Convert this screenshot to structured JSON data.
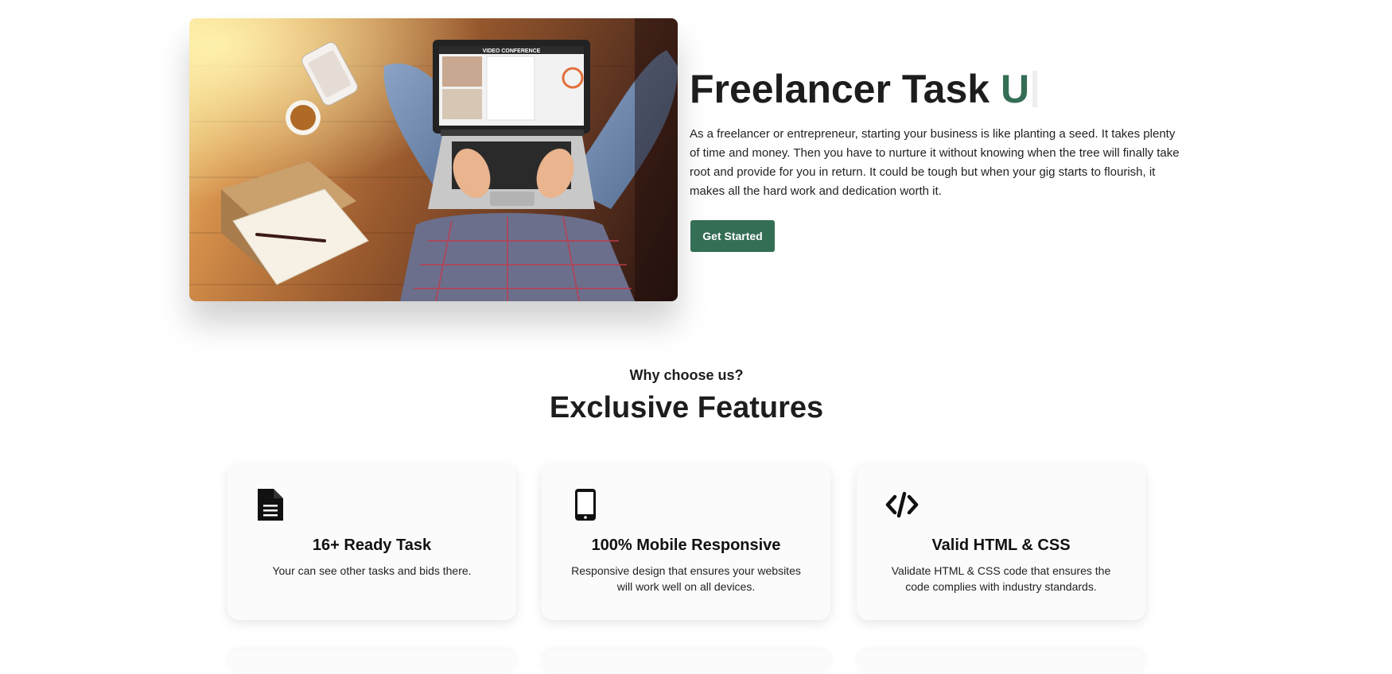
{
  "hero": {
    "title_static": "Freelancer Task ",
    "title_typed": "U",
    "description": "As a freelancer or entrepreneur, starting your business is like planting a seed. It takes plenty of time and money. Then you have to nurture it without knowing when the tree will finally take root and provide for you in return. It could be tough but when your gig starts to flourish, it makes all the hard work and dedication worth it.",
    "cta_label": "Get Started",
    "image": {
      "laptop_screen_title": "VIDEO CONFERENCE"
    }
  },
  "features_section": {
    "eyebrow": "Why choose us?",
    "title": "Exclusive Features",
    "cards": [
      {
        "icon": "document-icon",
        "title": "16+ Ready Task",
        "text": "Your can see other tasks and bids there."
      },
      {
        "icon": "mobile-phone-icon",
        "title": "100% Mobile Responsive",
        "text": "Responsive design that ensures your websites will work well on all devices."
      },
      {
        "icon": "code-icon",
        "title": "Valid HTML & CSS",
        "text": "Validate HTML & CSS code that ensures the code complies with industry standards."
      }
    ]
  },
  "colors": {
    "accent": "#346e55",
    "text": "#1d1d1d",
    "card_background": "#fbfbfb"
  }
}
